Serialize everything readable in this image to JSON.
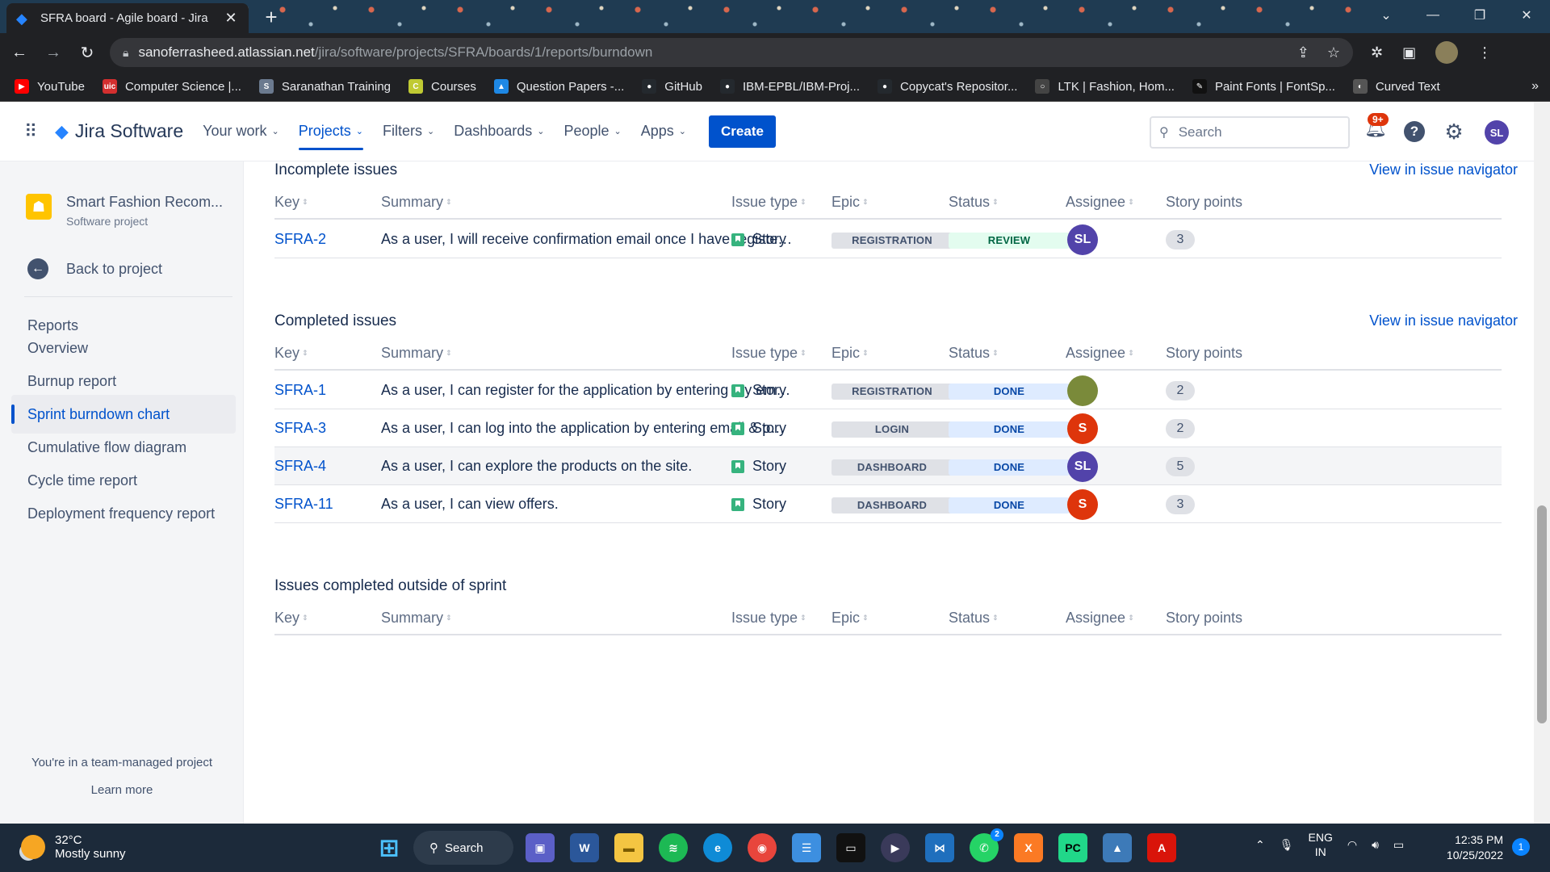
{
  "browser": {
    "tab_title": "SFRA board - Agile board - Jira",
    "url_host": "sanoferrasheed.atlassian.net",
    "url_path": "/jira/software/projects/SFRA/boards/1/reports/burndown",
    "bookmarks": [
      {
        "label": "YouTube",
        "color": "#ff0000",
        "icon": "youtube-icon",
        "glyph": "▶"
      },
      {
        "label": "Computer Science |...",
        "color": "#d32f2f",
        "icon": "uic-icon",
        "glyph": "uic"
      },
      {
        "label": "Saranathan Training",
        "color": "#6b7a8f",
        "icon": "training-icon",
        "glyph": "S"
      },
      {
        "label": "Courses",
        "color": "#c0ca33",
        "icon": "courses-icon",
        "glyph": "C"
      },
      {
        "label": "Question Papers -...",
        "color": "#1e88e5",
        "icon": "drive-icon",
        "glyph": "▲"
      },
      {
        "label": "GitHub",
        "color": "#24292e",
        "icon": "github-icon",
        "glyph": "●"
      },
      {
        "label": "IBM-EPBL/IBM-Proj...",
        "color": "#24292e",
        "icon": "github-icon",
        "glyph": "●"
      },
      {
        "label": "Copycat's Repositor...",
        "color": "#24292e",
        "icon": "github-icon",
        "glyph": "●"
      },
      {
        "label": "LTK | Fashion, Hom...",
        "color": "#444444",
        "icon": "ltk-icon",
        "glyph": "○"
      },
      {
        "label": "Paint Fonts | FontSp...",
        "color": "#111111",
        "icon": "fontspace-icon",
        "glyph": "✎"
      },
      {
        "label": "Curved Text",
        "color": "#555555",
        "icon": "curvedtext-icon",
        "glyph": "◐"
      }
    ],
    "more_glyph": "»"
  },
  "jira": {
    "product": "Jira Software",
    "nav": [
      {
        "label": "Your work",
        "active": false
      },
      {
        "label": "Projects",
        "active": true
      },
      {
        "label": "Filters",
        "active": false
      },
      {
        "label": "Dashboards",
        "active": false
      },
      {
        "label": "People",
        "active": false
      },
      {
        "label": "Apps",
        "active": false
      }
    ],
    "create_label": "Create",
    "search_placeholder": "Search",
    "notif_badge": "9+",
    "user_initials": "SL"
  },
  "sidebar": {
    "project_name": "Smart Fashion Recom...",
    "project_type": "Software project",
    "back_label": "Back to project",
    "reports_heading": "Reports",
    "items": [
      {
        "label": "Overview",
        "active": false
      },
      {
        "label": "Burnup report",
        "active": false
      },
      {
        "label": "Sprint burndown chart",
        "active": true
      },
      {
        "label": "Cumulative flow diagram",
        "active": false
      },
      {
        "label": "Cycle time report",
        "active": false
      },
      {
        "label": "Deployment frequency report",
        "active": false
      }
    ],
    "team_note": "You're in a team-managed project",
    "learn_more": "Learn more"
  },
  "columns": [
    "Key",
    "Summary",
    "Issue type",
    "Epic",
    "Status",
    "Assignee",
    "Story points"
  ],
  "sections": [
    {
      "title": "Incomplete issues",
      "link": "View in issue navigator",
      "rows": [
        {
          "key": "SFRA-2",
          "summary": "As a user, I will receive confirmation email once I have registered...",
          "type": "Story",
          "epic": "REGISTRATION",
          "status": "REVIEW",
          "assignee": "SL",
          "assignee_color": "#5243aa",
          "points": "3"
        }
      ]
    },
    {
      "title": "Completed issues",
      "link": "View in issue navigator",
      "rows": [
        {
          "key": "SFRA-1",
          "summary": "As a user, I can register for the application by entering my email,...",
          "type": "Story",
          "epic": "REGISTRATION",
          "status": "DONE",
          "assignee": "",
          "assignee_color": "#7a8a3a",
          "points": "2"
        },
        {
          "key": "SFRA-3",
          "summary": "As a user, I can log into the application by entering email & pass...",
          "type": "Story",
          "epic": "LOGIN",
          "status": "DONE",
          "assignee": "S",
          "assignee_color": "#de350b",
          "points": "2"
        },
        {
          "key": "SFRA-4",
          "summary": "As a user, I can explore the products on the site.",
          "type": "Story",
          "epic": "DASHBOARD",
          "status": "DONE",
          "assignee": "SL",
          "assignee_color": "#5243aa",
          "points": "5"
        },
        {
          "key": "SFRA-11",
          "summary": "As a user, I can view offers.",
          "type": "Story",
          "epic": "DASHBOARD",
          "status": "DONE",
          "assignee": "S",
          "assignee_color": "#de350b",
          "points": "3"
        }
      ]
    },
    {
      "title": "Issues completed outside of sprint",
      "link": "",
      "rows": []
    }
  ],
  "taskbar": {
    "temp": "32°C",
    "weather": "Mostly sunny",
    "search_label": "Search",
    "lang1": "ENG",
    "lang2": "IN",
    "time": "12:35 PM",
    "date": "10/25/2022",
    "whatsapp_badge": "2",
    "notif_count": "1"
  }
}
